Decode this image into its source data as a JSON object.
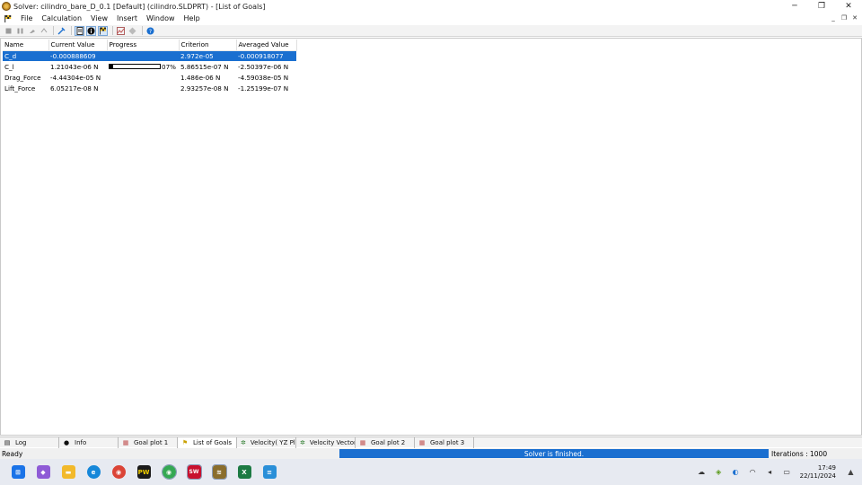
{
  "window": {
    "title": "Solver: cilindro_bare_D_0.1 [Default] (cilindro.SLDPRT) - [List of Goals]",
    "minimize_glyph": "─",
    "maximize_glyph": "❐",
    "close_glyph": "✕"
  },
  "menu": {
    "items": [
      "File",
      "Calculation",
      "View",
      "Insert",
      "Window",
      "Help"
    ],
    "mdi_minimize": "_",
    "mdi_restore": "❐",
    "mdi_close": "✕"
  },
  "toolbar": {
    "icons": [
      "stop-icon",
      "pause-icon",
      "pin-icon",
      "refresh-icon",
      "goal-tree-icon",
      "document-icon",
      "info-icon",
      "flag-icon",
      "chart-icon",
      "target-icon",
      "help-icon"
    ]
  },
  "table": {
    "columns": [
      "Name",
      "Current Value",
      "Progress",
      "Criterion",
      "Averaged Value"
    ],
    "rows": [
      {
        "name": "C_d",
        "current": "-0.000888609",
        "progress_text": "",
        "progress_fraction": 0,
        "criterion": "2.972e-05",
        "averaged": "-0.000918077"
      },
      {
        "name": "C_l",
        "current": "1.21043e-06 N",
        "progress_text": "07%",
        "progress_fraction": 0.07,
        "criterion": "5.86515e-07 N",
        "averaged": "-2.50397e-06 N"
      },
      {
        "name": "Drag_Force",
        "current": "-4.44304e-05 N",
        "progress_text": "",
        "progress_fraction": 0,
        "criterion": "1.486e-06 N",
        "averaged": "-4.59038e-05 N"
      },
      {
        "name": "Lift_Force",
        "current": "6.05217e-08 N",
        "progress_text": "",
        "progress_fraction": 0,
        "criterion": "2.93257e-08 N",
        "averaged": "-1.25199e-07 N"
      }
    ]
  },
  "tabs": [
    {
      "label": "Log",
      "icon": "log-icon",
      "glyph": "▤"
    },
    {
      "label": "Info",
      "icon": "info-icon",
      "glyph": "●"
    },
    {
      "label": "Goal plot 1",
      "icon": "goal-plot-icon",
      "glyph": "▦"
    },
    {
      "label": "List of Goals",
      "icon": "flag-icon",
      "glyph": "⚑"
    },
    {
      "label": "Velocity( YZ Pla",
      "icon": "cut-plot-icon",
      "glyph": "✲"
    },
    {
      "label": "Velocity Vectors",
      "icon": "cut-plot-icon",
      "glyph": "✲"
    },
    {
      "label": "Goal plot 2",
      "icon": "goal-plot-icon",
      "glyph": "▦"
    },
    {
      "label": "Goal plot 3",
      "icon": "goal-plot-icon",
      "glyph": "▦"
    }
  ],
  "status": {
    "ready": "Ready",
    "solver": "Solver is finished.",
    "iterations": "Iterations : 1000"
  },
  "taskbar": {
    "apps": [
      {
        "name": "windows-start-icon",
        "glyph": "⊞",
        "color": "#1a73e8"
      },
      {
        "name": "copilot-icon",
        "glyph": "◆",
        "color": "#8e5bd6"
      },
      {
        "name": "file-explorer-icon",
        "glyph": "▬",
        "color": "#f2b92b"
      },
      {
        "name": "edge-icon",
        "glyph": "e",
        "color": "#1687d9"
      },
      {
        "name": "chrome-icon",
        "glyph": "◉",
        "color": "#db4437"
      },
      {
        "name": "app-pw-icon",
        "glyph": "PW",
        "color": "#1b1b1b"
      },
      {
        "name": "chrome-profile-icon",
        "glyph": "◉",
        "color": "#34a853"
      },
      {
        "name": "solidworks-icon",
        "glyph": "SW",
        "color": "#c8102e"
      },
      {
        "name": "flow-simulation-icon",
        "glyph": "≋",
        "color": "#8a6d2c"
      },
      {
        "name": "excel-icon",
        "glyph": "X",
        "color": "#1d7a43"
      },
      {
        "name": "notepad-icon",
        "glyph": "≡",
        "color": "#2a8fd8"
      }
    ],
    "tray": [
      {
        "name": "weather-icon",
        "glyph": "☁"
      },
      {
        "name": "nvidia-icon",
        "glyph": "◈"
      },
      {
        "name": "security-icon",
        "glyph": "◐"
      },
      {
        "name": "wifi-icon",
        "glyph": "◠"
      },
      {
        "name": "volume-icon",
        "glyph": "◂"
      },
      {
        "name": "battery-icon",
        "glyph": "▭"
      }
    ],
    "time": "17:49",
    "date": "22/11/2024",
    "notification_glyph": "▲"
  }
}
